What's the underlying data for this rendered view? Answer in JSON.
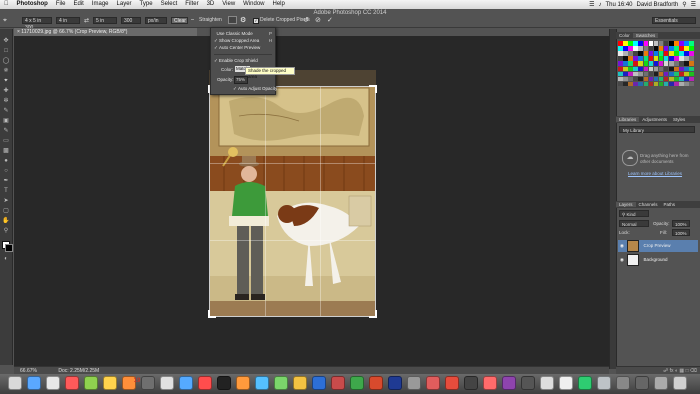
{
  "menubar": {
    "app": "Photoshop",
    "items": [
      "File",
      "Edit",
      "Image",
      "Layer",
      "Type",
      "Select",
      "Filter",
      "3D",
      "View",
      "Window",
      "Help"
    ],
    "clock": "Thu 16:40",
    "user": "David Bradforth"
  },
  "window": {
    "title": "Adobe Photoshop CC 2014"
  },
  "options": {
    "ratio": "4 x 5 in 300...",
    "w": "4 in",
    "h": "5 in",
    "res": "300",
    "unit": "px/in",
    "clear": "Clear",
    "straighten": "Straighten",
    "delete_cropped": "Delete Cropped Pixels",
    "search": "Essentials"
  },
  "doc": {
    "tab": "× 11710029.jpg @ 66.7% (Crop Preview, RGB/8*)",
    "zoom": "66.67%",
    "info": "Doc: 2.25M/2.25M"
  },
  "dropdown": {
    "items": [
      {
        "label": "Use Classic Mode",
        "shortcut": "P",
        "checked": false
      },
      {
        "label": "Show Cropped Area",
        "shortcut": "H",
        "checked": true
      },
      {
        "label": "Auto Center Preview",
        "shortcut": "",
        "checked": true
      },
      {
        "label": "Enable Crop Shield",
        "shortcut": "",
        "checked": true
      }
    ],
    "color_label": "Color:",
    "color_value": "Match",
    "opacity_label": "Opacity:",
    "opacity_value": "75%",
    "auto_adjust": "Auto Adjust Opacity"
  },
  "tooltip": "Shade the cropped area",
  "panels": {
    "color_tabs": [
      "Color",
      "Swatches"
    ],
    "lib_tabs": [
      "Libraries",
      "Adjustments",
      "Styles"
    ],
    "library_select": "My Library",
    "library_msg1": "Drag anything here from",
    "library_msg2": "other documents",
    "library_link": "Learn more about Libraries",
    "layer_tabs": [
      "Layers",
      "Channels",
      "Paths"
    ],
    "kind": "Kind",
    "blend": "Normal",
    "opacity_label": "Opacity:",
    "opacity_value": "100%",
    "lock_label": "Lock:",
    "fill_label": "Fill:",
    "fill_value": "100%",
    "layers": [
      "Crop Preview",
      "Background"
    ]
  },
  "dock": {
    "calendar": "19"
  },
  "colors": {
    "accent": "#4d7bb5",
    "ui_dark": "#282828",
    "panel": "#535353"
  }
}
